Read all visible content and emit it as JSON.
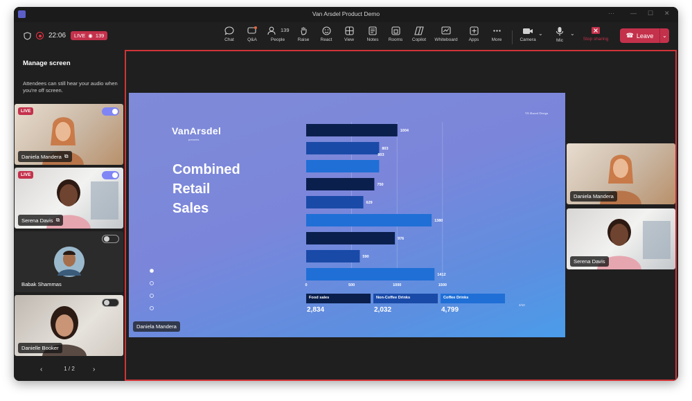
{
  "window": {
    "title": "Van Arsdel Product Demo"
  },
  "status": {
    "time": "22:06",
    "live_label": "LIVE",
    "viewers": "139"
  },
  "toolbar": {
    "items": [
      {
        "label": "Chat",
        "icon": "chat-icon"
      },
      {
        "label": "Q&A",
        "icon": "qna-icon"
      },
      {
        "label": "People",
        "icon": "people-icon",
        "count": "139"
      },
      {
        "label": "Raise",
        "icon": "raise-hand-icon"
      },
      {
        "label": "React",
        "icon": "react-icon"
      },
      {
        "label": "View",
        "icon": "view-icon"
      },
      {
        "label": "Notes",
        "icon": "notes-icon"
      },
      {
        "label": "Rooms",
        "icon": "rooms-icon"
      },
      {
        "label": "Copilot",
        "icon": "copilot-icon"
      },
      {
        "label": "Whiteboard",
        "icon": "whiteboard-icon"
      },
      {
        "label": "Apps",
        "icon": "apps-icon"
      },
      {
        "label": "More",
        "icon": "more-icon"
      }
    ],
    "camera_label": "Camera",
    "mic_label": "Mic",
    "stop_sharing_label": "Stop sharing",
    "leave_label": "Leave"
  },
  "sidebar": {
    "title": "Manage screen",
    "note": "Attendees can still hear your audio when you're off screen.",
    "participants": [
      {
        "name": "Daniela Mandera",
        "live": "LIVE",
        "on": true
      },
      {
        "name": "Serena Davis",
        "live": "LIVE",
        "on": true
      },
      {
        "name": "Babak Shammas",
        "live": "",
        "on": false
      },
      {
        "name": "Danielle Booker",
        "live": "",
        "on": false
      }
    ],
    "pager": "1 / 2"
  },
  "slide": {
    "brand": "VanArsdel",
    "presents": "presents",
    "shared_by": "VA Shared Design",
    "headline": [
      "Combined",
      "Retail",
      "Sales"
    ],
    "presenter": "Daniela Mandera",
    "page": "2/10"
  },
  "stage_participants": [
    {
      "name": "Daniela Mandera"
    },
    {
      "name": "Serena Davis"
    }
  ],
  "colors": {
    "food": "#0b1f4d",
    "noncoffee": "#1a4aa8",
    "coffee": "#1f6fd6",
    "accent": "#7f85f5",
    "leave": "#c4314b",
    "share_border": "#d13438"
  },
  "chart_data": {
    "type": "bar",
    "orientation": "horizontal",
    "groups": 3,
    "series": [
      {
        "name": "Food sales",
        "values": [
          1004,
          750,
          976
        ]
      },
      {
        "name": "Non-Coffee Drinks",
        "values": [
          803,
          629,
          590
        ]
      },
      {
        "name": "Coffee Drinks",
        "values": [
          803,
          1380,
          1412
        ]
      }
    ],
    "value_labels": [
      "1004",
      "803",
      "803",
      "750",
      "629",
      "1380",
      "976",
      "590",
      "1412"
    ],
    "xticks": [
      "0",
      "500",
      "1000",
      "1500"
    ],
    "xlim": [
      0,
      2050
    ],
    "grid": true,
    "totals": [
      {
        "name": "Food sales",
        "value": "2,834"
      },
      {
        "name": "Non-Coffee Drinks",
        "value": "2,032"
      },
      {
        "name": "Coffee Drinks",
        "value": "4,799"
      }
    ]
  }
}
